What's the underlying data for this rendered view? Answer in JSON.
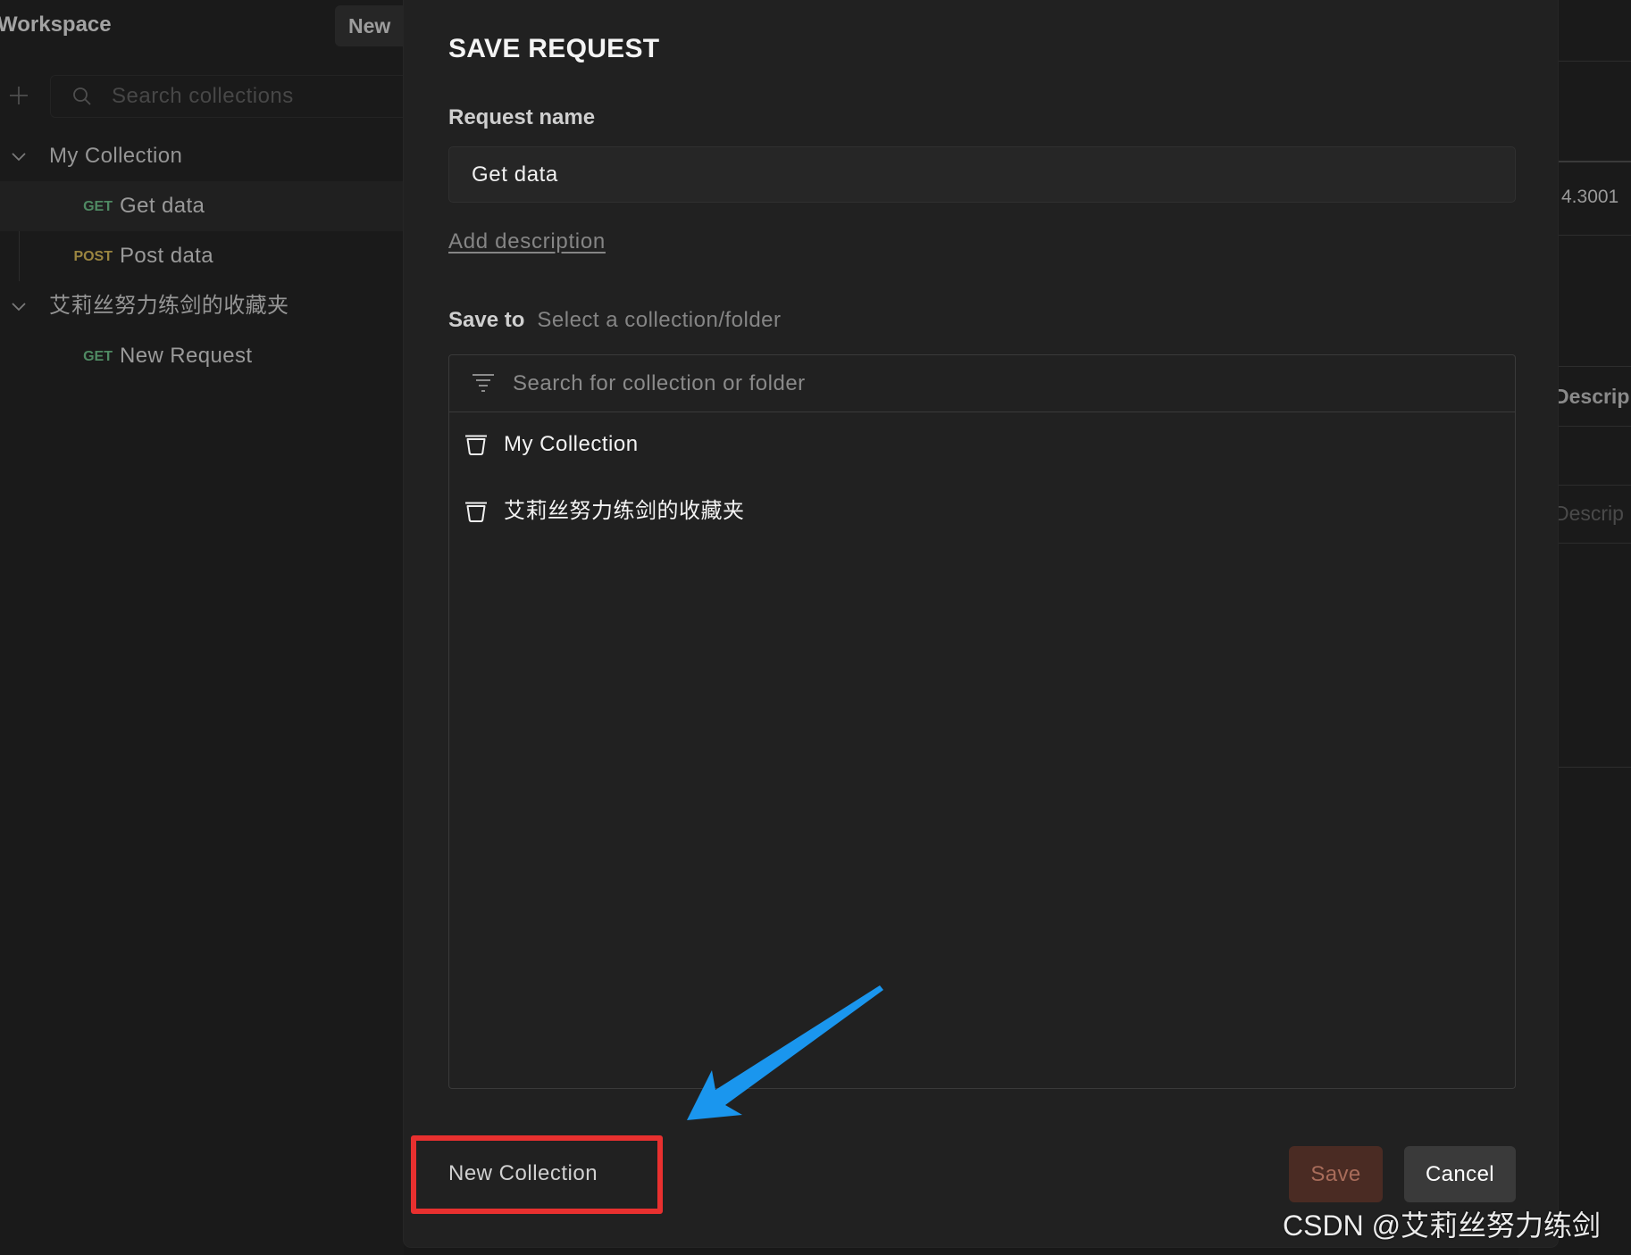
{
  "sidebar": {
    "workspace_title": "Workspace",
    "new_button": "New",
    "add_icon": "plus-icon",
    "search_icon": "search-icon",
    "search_placeholder": "Search collections",
    "collections": [
      {
        "name": "My Collection",
        "expanded": true,
        "requests": [
          {
            "method": "GET",
            "name": "Get data",
            "selected": true
          },
          {
            "method": "POST",
            "name": "Post data",
            "selected": false
          }
        ]
      },
      {
        "name": "艾莉丝努力练剑的收藏夹",
        "expanded": true,
        "requests": [
          {
            "method": "GET",
            "name": "New Request",
            "selected": false
          }
        ]
      }
    ]
  },
  "modal": {
    "title": "SAVE REQUEST",
    "request_name_label": "Request name",
    "request_name_value": "Get data",
    "add_description": "Add description",
    "save_to_label": "Save to",
    "save_to_hint": "Select a collection/folder",
    "filter_icon": "filter-icon",
    "search_placeholder": "Search for collection or folder",
    "destinations": [
      {
        "name": "My Collection",
        "icon": "collection-icon"
      },
      {
        "name": "艾莉丝努力练剑的收藏夹",
        "icon": "collection-icon"
      }
    ],
    "new_collection": "New Collection",
    "save_button": "Save",
    "cancel_button": "Cancel"
  },
  "background_panel": {
    "value": "4.3001",
    "column_header": "Descrip",
    "placeholder": "Descrip"
  },
  "watermark": "CSDN @艾莉丝努力练剑",
  "colors": {
    "get_method": "#4f8a63",
    "post_method": "#9a8540",
    "save_button_bg": "#4a2b23",
    "save_button_text": "#a86c5a",
    "cancel_button_bg": "#3a3a3a",
    "cancel_button_text": "#ffffff",
    "annotation_box": "#e8302f",
    "annotation_arrow": "#1a96ee"
  }
}
